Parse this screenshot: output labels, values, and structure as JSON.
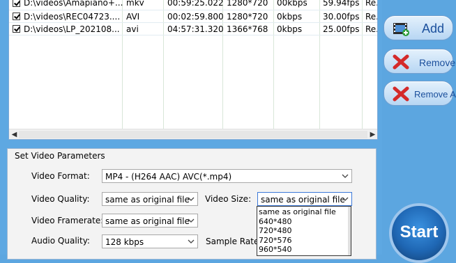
{
  "files": [
    {
      "path": "D:\\videos\\Amapiano+...",
      "format": "mkv",
      "duration": "00:59:25.022",
      "resolution": "1280*720",
      "bitrate": "00kbps",
      "fps": "59.94fps",
      "status": "Re..."
    },
    {
      "path": "D:\\videos\\REC04723....",
      "format": "AVI",
      "duration": "00:02:59.800",
      "resolution": "1280*720",
      "bitrate": "0kbps",
      "fps": "30.00fps",
      "status": "Re..."
    },
    {
      "path": "D:\\videos\\LP_202108...",
      "format": "avi",
      "duration": "04:57:31.320",
      "resolution": "1366*768",
      "bitrate": "0kbps",
      "fps": "25.00fps",
      "status": "Re..."
    }
  ],
  "buttons": {
    "add": "Add",
    "remove": "Remove",
    "remove_all": "Remove All",
    "start": "Start"
  },
  "params": {
    "title": "Set Video Parameters",
    "video_format_label": "Video Format:",
    "video_format_value": "MP4 - (H264 AAC) AVC(*.mp4)",
    "video_quality_label": "Video Quality:",
    "video_quality_value": "same as original file",
    "video_size_label": "Video Size:",
    "video_size_value": "same as original file",
    "video_framerate_label": "Video Framerate:",
    "video_framerate_value": "same as original file",
    "audio_quality_label": "Audio Quality:",
    "audio_quality_value": "128 kbps",
    "sample_rate_label": "Sample Rate:"
  },
  "size_options": [
    "same as original file",
    "640*480",
    "720*480",
    "720*576",
    "960*540"
  ],
  "colors": {
    "accent": "#3b78d8",
    "start_button": "#1f67b4",
    "remove_icon": "#d42a2a"
  },
  "icons": {
    "add": "film-add-icon",
    "remove": "red-x-icon",
    "remove_all": "red-x-icon"
  }
}
